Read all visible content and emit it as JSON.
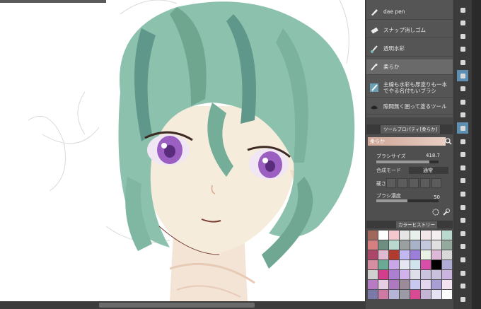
{
  "subtool_palette": {
    "items": [
      {
        "label": "dae pen",
        "icon": "pen-icon",
        "selected": false
      },
      {
        "label": "スナップ消しゴム",
        "icon": "eraser-icon",
        "selected": false
      },
      {
        "label": "透明水彩",
        "icon": "brush-icon",
        "selected": false
      },
      {
        "label": "柔らか",
        "icon": "airbrush-icon",
        "selected": true
      },
      {
        "label": "主線も水彩も厚塗りも一本でやる名付もいブラシ",
        "icon": "brush-icon",
        "selected": false
      },
      {
        "label": "隙間無く囲って塗るツール",
        "icon": "fill-icon",
        "selected": false
      }
    ]
  },
  "tool_property": {
    "tab_label": "ツールプロパティ[柔らか]",
    "tool_name": "柔らか",
    "brush_size_label": "ブラシサイズ",
    "brush_size_value": "418.7",
    "brush_size_fraction": 0.85,
    "blend_mode_label": "合成モード",
    "blend_mode_value": "通常",
    "hardness_label": "硬さ",
    "brush_density_label": "ブラシ濃度",
    "brush_density_value": "50",
    "brush_density_fraction": 0.5
  },
  "color_history": {
    "tab_label": "カラーヒストリー",
    "swatches": [
      "#a0685c",
      "#ffffff",
      "#f4c7cf",
      "#e5e5e5",
      "#e8f0ec",
      "#f3e7ea",
      "#f4eef0",
      "#b9d9ce",
      "#d87f82",
      "#6c8f82",
      "#b9d9cf",
      "#9aa0a0",
      "#a9b3c7",
      "#c4c9e0",
      "#e0e0e0",
      "#95aa9e",
      "#ab4869",
      "#e1b9d0",
      "#b23b2f",
      "#c2b9f0",
      "#9c7fd8",
      "#eaf3e3",
      "#deb8d8",
      "#d8d8d8",
      "#d68ea2",
      "#6aaa94",
      "#c9a7e7",
      "#e6e6f3",
      "#d1e4ee",
      "#d94ea9",
      "#000000",
      "#b0acd8",
      "#d0d0d0",
      "#d43d8c",
      "#ac7fd3",
      "#d0b2ec",
      "#dfdfea",
      "#c9c3df",
      "#c9c0dc",
      "#cbb4e0",
      "#b77bc4",
      "#e7cfe3",
      "#ae7abf",
      "#9a8a9a",
      "#c8c8f0",
      "#e2d7ee",
      "#a99ed3",
      "#f4e4f1",
      "#7b79a8",
      "#cd7ba2",
      "#b5b5d8",
      "#9b9ba5",
      "#d84a92",
      "#c4b4d6",
      "#e7e2f3",
      "#ffffff"
    ]
  },
  "tools": [
    {
      "icon": "hand-icon",
      "active": false
    },
    {
      "icon": "zoom-icon",
      "active": false
    },
    {
      "icon": "move-icon",
      "active": false
    },
    {
      "icon": "operation-icon",
      "active": false
    },
    {
      "icon": "eyedropper-icon",
      "active": false
    },
    {
      "icon": "selection-icon",
      "active": true
    },
    {
      "icon": "magic-wand-icon",
      "active": false
    },
    {
      "icon": "pen-tool-icon",
      "active": false
    },
    {
      "icon": "pencil-tool-icon",
      "active": false
    },
    {
      "icon": "brush-tool-icon",
      "active": true
    },
    {
      "icon": "airbrush-tool-icon",
      "active": false
    },
    {
      "icon": "decoration-tool-icon",
      "active": false
    },
    {
      "icon": "eraser-tool-icon",
      "active": false
    },
    {
      "icon": "blend-tool-icon",
      "active": false
    },
    {
      "icon": "fill-tool-icon",
      "active": false
    },
    {
      "icon": "gradient-tool-icon",
      "active": false
    },
    {
      "icon": "figure-tool-icon",
      "active": false
    },
    {
      "icon": "frame-tool-icon",
      "active": false
    },
    {
      "icon": "ruler-tool-icon",
      "active": false
    },
    {
      "icon": "text-tool-icon",
      "active": false
    },
    {
      "icon": "balloon-tool-icon",
      "active": false
    },
    {
      "icon": "line-correction-icon",
      "active": false
    },
    {
      "icon": "color-swatch-icon",
      "active": false
    }
  ]
}
